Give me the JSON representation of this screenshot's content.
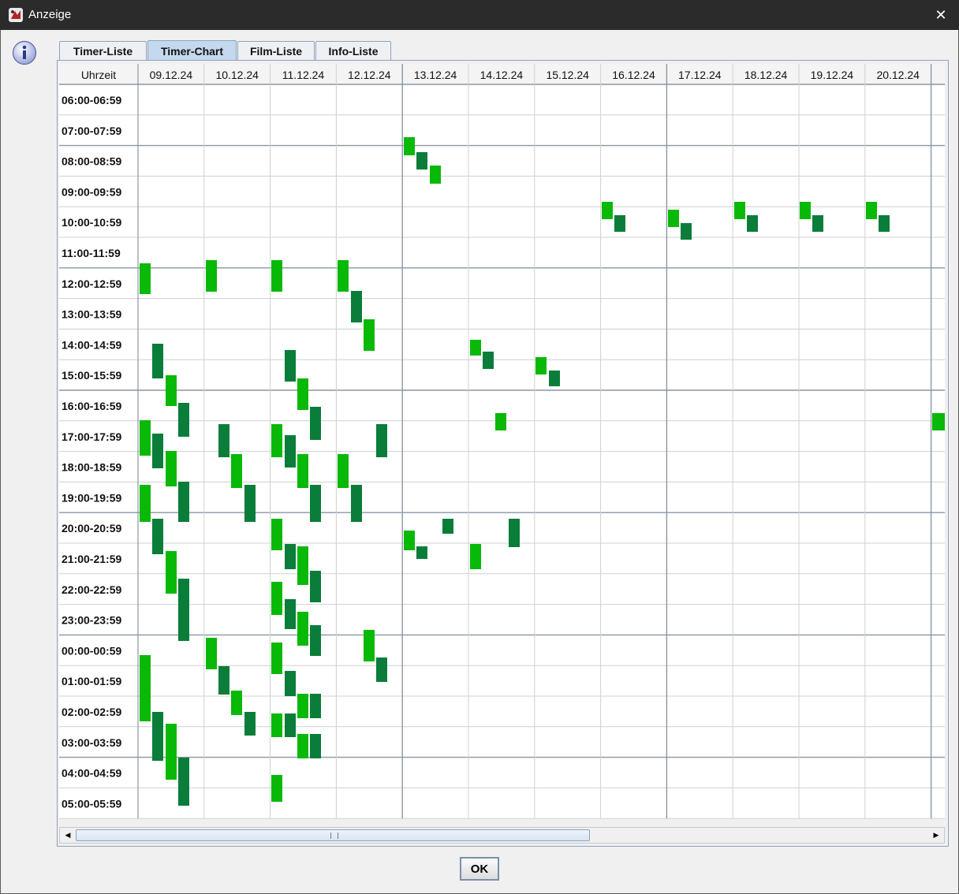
{
  "window": {
    "title": "Anzeige",
    "close_glyph": "✕",
    "icon": "app-icon"
  },
  "info_icon": "info-icon",
  "tabs": [
    {
      "label": "Timer-Liste",
      "selected": false
    },
    {
      "label": "Timer-Chart",
      "selected": true
    },
    {
      "label": "Film-Liste",
      "selected": false
    },
    {
      "label": "Info-Liste",
      "selected": false
    }
  ],
  "chart": {
    "corner_label": "Uhrzeit",
    "dates": [
      "09.12.24",
      "10.12.24",
      "11.12.24",
      "12.12.24",
      "13.12.24",
      "14.12.24",
      "15.12.24",
      "16.12.24",
      "17.12.24",
      "18.12.24",
      "19.12.24",
      "20.12.24"
    ],
    "hours": [
      "06:00-06:59",
      "07:00-07:59",
      "08:00-08:59",
      "09:00-09:59",
      "10:00-10:59",
      "11:00-11:59",
      "12:00-12:59",
      "13:00-13:59",
      "14:00-14:59",
      "15:00-15:59",
      "16:00-16:59",
      "17:00-17:59",
      "18:00-18:59",
      "19:00-19:59",
      "20:00-20:59",
      "21:00-21:59",
      "22:00-22:59",
      "23:00-23:59",
      "00:00-00:59",
      "01:00-01:59",
      "02:00-02:59",
      "03:00-03:59",
      "04:00-04:59",
      "05:00-05:59"
    ],
    "colors": {
      "light": "#08b908",
      "dark": "#0a7d3a",
      "grid": "#d0d0d0",
      "grid_major": "#8a96a4"
    }
  },
  "ok_button": {
    "label": "OK"
  },
  "scrollbar": {
    "left_arrow": "◀",
    "right_arrow": "▶",
    "grip": "|||"
  }
}
